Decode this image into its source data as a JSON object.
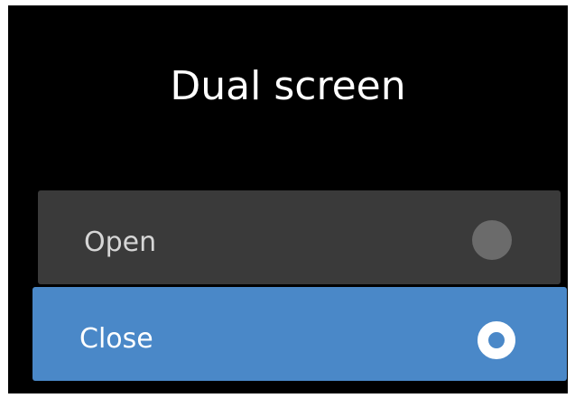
{
  "dialog": {
    "title": "Dual screen",
    "options": [
      {
        "label": "Open",
        "selected": false,
        "radio_icon": "radio-unselected-icon"
      },
      {
        "label": "Close",
        "selected": true,
        "radio_icon": "radio-selected-icon"
      }
    ]
  },
  "colors": {
    "background": "#000000",
    "title_text": "#ffffff",
    "option_background": "#3a3a3a",
    "option_text": "#d6d6d6",
    "selected_background": "#4a88c8",
    "selected_text": "#ffffff",
    "radio_off": "#6b6b6b",
    "radio_on": "#ffffff"
  }
}
